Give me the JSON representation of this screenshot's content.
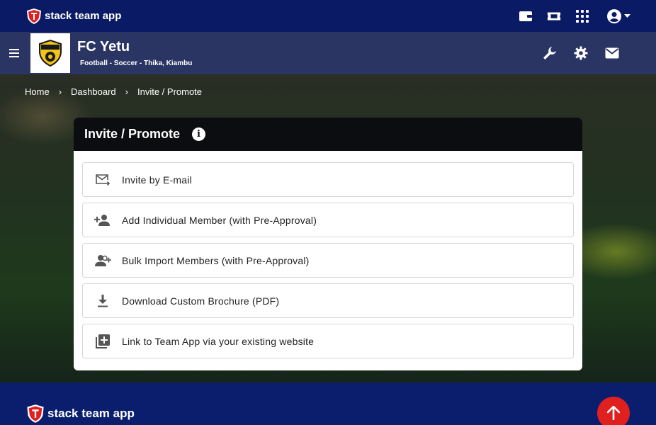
{
  "topbar": {
    "brand": "stack team app",
    "icons": [
      "wallet-icon",
      "ticket-icon",
      "apps-grid-icon",
      "account-icon"
    ]
  },
  "team": {
    "name": "FC Yetu",
    "subtitle": "Football - Soccer - Thika, Kiambu",
    "icons": [
      "wrench-icon",
      "gear-icon",
      "mail-icon"
    ]
  },
  "breadcrumb": {
    "items": [
      "Home",
      "Dashboard",
      "Invite / Promote"
    ],
    "separator": "›"
  },
  "card": {
    "title": "Invite / Promote",
    "info_glyph": "i",
    "options": [
      {
        "label": "Invite by E-mail",
        "icon": "email-forward-icon"
      },
      {
        "label": "Add Individual Member (with Pre-Approval)",
        "icon": "person-add-icon"
      },
      {
        "label": "Bulk Import Members (with Pre-Approval)",
        "icon": "group-add-icon"
      },
      {
        "label": "Download Custom Brochure (PDF)",
        "icon": "download-icon"
      },
      {
        "label": "Link to Team App via your existing website",
        "icon": "library-add-icon"
      }
    ]
  },
  "footer": {
    "brand": "stack team app"
  },
  "colors": {
    "topbar": "#0b1a64",
    "teambar": "#2a3564",
    "card_header": "#0c0d10",
    "scroll_top": "#e0201e"
  }
}
